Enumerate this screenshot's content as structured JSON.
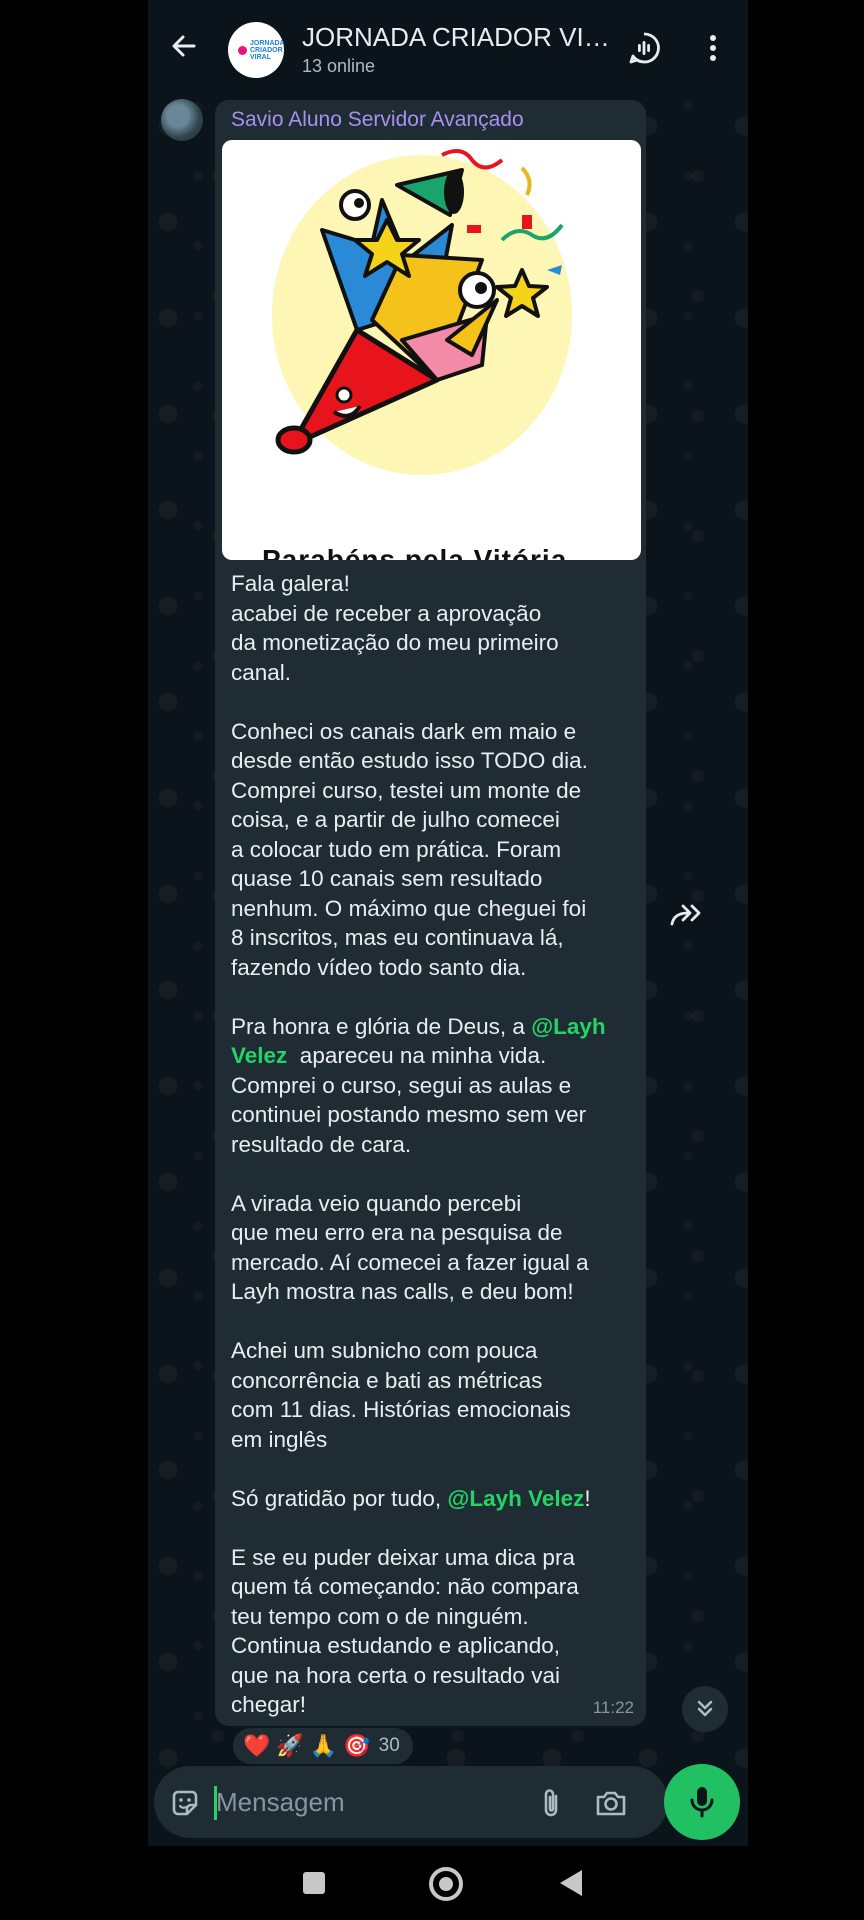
{
  "header": {
    "title": "JORNADA CRIADOR VIRAL",
    "subtitle": "13 online",
    "avatar_text": "JORNADA CRIADOR VIRAL"
  },
  "message": {
    "sender": "Savio Aluno Servidor Avançado",
    "image_caption_fragment": "Parabéns pela Vitória",
    "paragraphs": {
      "p1": "Fala galera!\nacabei de receber a aprovação\nda monetização do meu primeiro\ncanal.",
      "p2": "Conheci os canais dark em maio e\ndesde então estudo isso TODO dia.\nComprei curso, testei um monte de\ncoisa, e a partir de julho comecei\na colocar tudo em prática. Foram\nquase 10 canais sem resultado\nnenhum. O máximo que cheguei foi\n8 inscritos, mas eu continuava lá,\nfazendo vídeo todo santo dia.",
      "p3_pre": "Pra honra e glória de Deus, a ",
      "p3_mention": "@Layh\nVelez",
      "p3_post": "  apareceu na minha vida.\nComprei o curso, segui as aulas e\ncontinuei postando mesmo sem ver\nresultado de cara.",
      "p4": "A virada veio quando percebi\nque meu erro era na pesquisa de\nmercado. Aí comecei a fazer igual a\nLayh mostra nas calls, e deu bom!",
      "p5": "Achei um subnicho com pouca\nconcorrência e bati as métricas\ncom 11 dias. Histórias emocionais\nem inglês",
      "p6_pre": "Só gratidão por tudo, ",
      "p6_mention": "@Layh Velez",
      "p6_post": "!",
      "p7": "E se eu puder deixar uma dica pra\nquem tá começando: não compara\nteu tempo com o de ninguém.\nContinua estudando e aplicando,\nque na hora certa o resultado vai\nchegar!"
    },
    "time": "11:22"
  },
  "reactions": {
    "emojis": [
      "❤️",
      "🚀",
      "🙏",
      "🎯"
    ],
    "count": "30"
  },
  "input": {
    "placeholder": "Mensagem"
  },
  "colors": {
    "accent": "#25d366",
    "bubble": "#202c33",
    "background": "#0b141a",
    "sender_name": "#a98ff1"
  },
  "icons": [
    "back-arrow-icon",
    "voice-chat-icon",
    "more-vert-icon",
    "forward-icon",
    "chevron-double-down-icon",
    "sticker-icon",
    "paperclip-icon",
    "camera-icon",
    "mic-icon"
  ]
}
